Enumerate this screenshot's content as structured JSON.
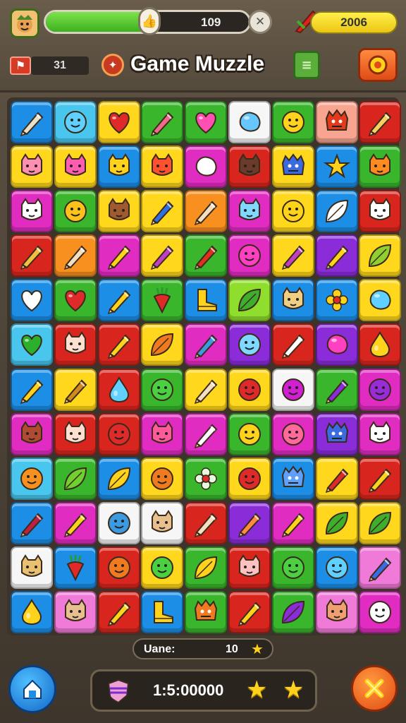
{
  "header": {
    "avatar_icon": "goblin-face-icon",
    "progress": {
      "value_text": "109",
      "fill_fraction": 0.5,
      "knob_icon": "thumbs-up-icon"
    },
    "close_icon": "x-icon",
    "coins": {
      "value": "2006",
      "icon": "red-feather-icon"
    },
    "level": {
      "icon": "red-flag-icon",
      "value": "31"
    },
    "title": "Game Muzzle",
    "logo_icon": "compass-badge-icon",
    "doc_icon": "green-document-icon",
    "menu_icon": "gear-creature-icon"
  },
  "board": {
    "colors": {
      "blue": "#1c8ee6",
      "cyan": "#49c6ee",
      "yellow": "#ffd71c",
      "green": "#39b62c",
      "red": "#d8261f",
      "magenta": "#e02cc0",
      "purple": "#8a2cd8",
      "white": "#f6f6f6",
      "peach": "#f7a590",
      "orange": "#f7901e",
      "pink": "#f07ad8",
      "lime": "#8fdd2c"
    },
    "rows": [
      [
        [
          "blue",
          "pencil",
          "#e8e2c8"
        ],
        [
          "cyan",
          "face",
          "#5fd0ff"
        ],
        [
          "yellow",
          "heart",
          "#e02a2a"
        ],
        [
          "green",
          "pencil",
          "#f06a8a"
        ],
        [
          "green",
          "heart",
          "#ff4fb0"
        ],
        [
          "white",
          "blob",
          "#66c6ff"
        ],
        [
          "green",
          "face",
          "#ffd21c"
        ],
        [
          "peach",
          "monster",
          "#e23a1c"
        ],
        [
          "red",
          "pencil",
          "#f6d060"
        ]
      ],
      [
        [
          "yellow",
          "cat",
          "#ff8fb0"
        ],
        [
          "yellow",
          "cat",
          "#ff5db0"
        ],
        [
          "blue",
          "cat",
          "#ffd21c"
        ],
        [
          "yellow",
          "cat",
          "#ff5030"
        ],
        [
          "magenta",
          "blob",
          "#ffffff"
        ],
        [
          "red",
          "cat",
          "#6a3a2a"
        ],
        [
          "yellow",
          "monster",
          "#3c6ae0"
        ],
        [
          "blue",
          "star",
          "#ffd21c"
        ],
        [
          "green",
          "cat",
          "#ff8a20"
        ]
      ],
      [
        [
          "magenta",
          "cat",
          "#ffffff"
        ],
        [
          "green",
          "face",
          "#ffc21c"
        ],
        [
          "yellow",
          "cat",
          "#a05a30"
        ],
        [
          "yellow",
          "pencil",
          "#3070e0"
        ],
        [
          "orange",
          "pencil",
          "#f4e0c0"
        ],
        [
          "magenta",
          "cat",
          "#7fd8ff"
        ],
        [
          "yellow",
          "face",
          "#ffd21c"
        ],
        [
          "blue",
          "leaf",
          "#ffffff"
        ],
        [
          "red",
          "cat",
          "#ffffff"
        ]
      ],
      [
        [
          "red",
          "pencil",
          "#f0c040"
        ],
        [
          "orange",
          "pencil",
          "#f4e0c0"
        ],
        [
          "magenta",
          "pencil",
          "#ffd21c"
        ],
        [
          "yellow",
          "pencil",
          "#c040c0"
        ],
        [
          "green",
          "pencil",
          "#e03020"
        ],
        [
          "magenta",
          "face",
          "#ff40c0"
        ],
        [
          "yellow",
          "pencil",
          "#c040c0"
        ],
        [
          "purple",
          "pencil",
          "#ffd21c"
        ],
        [
          "yellow",
          "leaf",
          "#8fd030"
        ]
      ],
      [
        [
          "blue",
          "heart",
          "#ffffff"
        ],
        [
          "green",
          "heart",
          "#e02a2a"
        ],
        [
          "blue",
          "pencil",
          "#ffd21c"
        ],
        [
          "green",
          "carrot",
          "#e02a2a"
        ],
        [
          "blue",
          "boot",
          "#ffd21c"
        ],
        [
          "lime",
          "leaf",
          "#3fae2c"
        ],
        [
          "blue",
          "cat",
          "#f0d080"
        ],
        [
          "blue",
          "flower",
          "#ffd21c"
        ],
        [
          "yellow",
          "blob",
          "#5fd0ff"
        ]
      ],
      [
        [
          "cyan",
          "heart",
          "#2cb02c"
        ],
        [
          "red",
          "cat",
          "#ffe0d0"
        ],
        [
          "red",
          "pencil",
          "#ffd21c"
        ],
        [
          "yellow",
          "leaf",
          "#f07a20"
        ],
        [
          "magenta",
          "pencil",
          "#3c9ae0"
        ],
        [
          "purple",
          "face",
          "#7fd8ff"
        ],
        [
          "red",
          "pencil",
          "#ffffff"
        ],
        [
          "purple",
          "blob",
          "#ff40c0"
        ],
        [
          "red",
          "drop",
          "#ffd21c"
        ]
      ],
      [
        [
          "blue",
          "pencil",
          "#ffd21c"
        ],
        [
          "yellow",
          "pencil",
          "#d08a20"
        ],
        [
          "red",
          "drop",
          "#5fd0ff"
        ],
        [
          "green",
          "face",
          "#4ad040"
        ],
        [
          "yellow",
          "pencil",
          "#f4e0c0"
        ],
        [
          "yellow",
          "face",
          "#e02a2a"
        ],
        [
          "white",
          "face",
          "#d020d0"
        ],
        [
          "green",
          "pencil",
          "#8a2cd8"
        ],
        [
          "magenta",
          "face",
          "#9a2cd8"
        ]
      ],
      [
        [
          "magenta",
          "cat",
          "#b04a30"
        ],
        [
          "red",
          "cat",
          "#ffe0d0"
        ],
        [
          "red",
          "face",
          "#e02a2a"
        ],
        [
          "magenta",
          "cat",
          "#ff5a9a"
        ],
        [
          "magenta",
          "pencil",
          "#ffffff"
        ],
        [
          "green",
          "face",
          "#ffd21c"
        ],
        [
          "magenta",
          "face",
          "#ff6a9a"
        ],
        [
          "purple",
          "monster",
          "#3c6ae0"
        ],
        [
          "magenta",
          "cat",
          "#ffffff"
        ]
      ],
      [
        [
          "cyan",
          "face",
          "#f7901e"
        ],
        [
          "green",
          "leaf",
          "#6fd030"
        ],
        [
          "blue",
          "leaf",
          "#ffd21c"
        ],
        [
          "yellow",
          "face",
          "#f07a20"
        ],
        [
          "green",
          "flower",
          "#e8f8e0"
        ],
        [
          "yellow",
          "face",
          "#e02a2a"
        ],
        [
          "blue",
          "monster",
          "#5fa0ff"
        ],
        [
          "yellow",
          "pencil",
          "#e02a2a"
        ],
        [
          "red",
          "pencil",
          "#ffd21c"
        ]
      ],
      [
        [
          "blue",
          "pencil",
          "#c02040"
        ],
        [
          "magenta",
          "pencil",
          "#ffd21c"
        ],
        [
          "white",
          "face",
          "#3c9ae0"
        ],
        [
          "white",
          "cat",
          "#e8c090"
        ],
        [
          "red",
          "pencil",
          "#f4e0c0"
        ],
        [
          "purple",
          "pencil",
          "#ff8a40"
        ],
        [
          "magenta",
          "pencil",
          "#ffd21c"
        ],
        [
          "yellow",
          "leaf",
          "#3fae2c"
        ],
        [
          "yellow",
          "leaf",
          "#3fae2c"
        ]
      ],
      [
        [
          "white",
          "cat",
          "#e8c070"
        ],
        [
          "blue",
          "carrot",
          "#e02a2a"
        ],
        [
          "red",
          "face",
          "#f07a20"
        ],
        [
          "yellow",
          "face",
          "#4ad040"
        ],
        [
          "green",
          "leaf",
          "#ffd21c"
        ],
        [
          "red",
          "cat",
          "#ffc0c0"
        ],
        [
          "green",
          "face",
          "#4ad040"
        ],
        [
          "blue",
          "face",
          "#5fd0ff"
        ],
        [
          "pink",
          "pencil",
          "#3c6ae0"
        ]
      ],
      [
        [
          "blue",
          "drop",
          "#ffd21c"
        ],
        [
          "pink",
          "cat",
          "#e8c090"
        ],
        [
          "red",
          "pencil",
          "#ffd21c"
        ],
        [
          "blue",
          "boot",
          "#ffd21c"
        ],
        [
          "green",
          "monster",
          "#f07a20"
        ],
        [
          "red",
          "pencil",
          "#ffd21c"
        ],
        [
          "green",
          "leaf",
          "#8a2cd8"
        ],
        [
          "pink",
          "cat",
          "#f0a070"
        ],
        [
          "magenta",
          "face",
          "#ffffff"
        ]
      ]
    ]
  },
  "status": {
    "label": "Uane:",
    "value": "10",
    "icon": "star-icon"
  },
  "footer": {
    "home_icon": "home-icon",
    "shield_icon": "shield-icon",
    "score": "1:5:00000",
    "stars": [
      "star-icon",
      "star-icon"
    ],
    "close_icon": "close-x-icon"
  }
}
